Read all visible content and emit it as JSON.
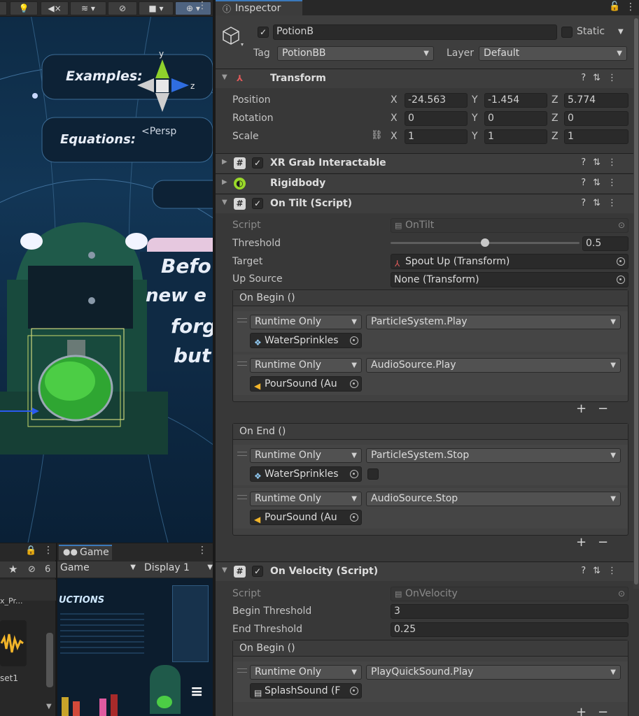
{
  "inspector": {
    "tab_label": "Inspector",
    "object_name": "PotionB",
    "static_label": "Static",
    "tag_label": "Tag",
    "tag_value": "PotionBB",
    "layer_label": "Layer",
    "layer_value": "Default"
  },
  "transform": {
    "title": "Transform",
    "position_label": "Position",
    "rotation_label": "Rotation",
    "scale_label": "Scale",
    "axis_x": "X",
    "axis_y": "Y",
    "axis_z": "Z",
    "position": {
      "x": "-24.563",
      "y": "-1.454",
      "z": "5.774"
    },
    "rotation": {
      "x": "0",
      "y": "0",
      "z": "0"
    },
    "scale": {
      "x": "1",
      "y": "1",
      "z": "1"
    }
  },
  "components": {
    "xr_grab": "XR Grab Interactable",
    "rigidbody": "Rigidbody"
  },
  "on_tilt": {
    "title": "On Tilt (Script)",
    "script_label": "Script",
    "script_value": "OnTilt",
    "threshold_label": "Threshold",
    "threshold_value": "0.5",
    "threshold_fraction": 0.5,
    "target_label": "Target",
    "target_value": "Spout Up (Transform)",
    "up_source_label": "Up Source",
    "up_source_value": "None (Transform)",
    "on_begin": {
      "title": "On Begin ()",
      "entries": [
        {
          "mode": "Runtime Only",
          "function": "ParticleSystem.Play",
          "object": "WaterSprinkles"
        },
        {
          "mode": "Runtime Only",
          "function": "AudioSource.Play",
          "object": "PourSound (Au"
        }
      ]
    },
    "on_end": {
      "title": "On End ()",
      "entries": [
        {
          "mode": "Runtime Only",
          "function": "ParticleSystem.Stop",
          "object": "WaterSprinkles"
        },
        {
          "mode": "Runtime Only",
          "function": "AudioSource.Stop",
          "object": "PourSound (Au"
        }
      ]
    },
    "plus": "+",
    "minus": "−"
  },
  "on_velocity": {
    "title": "On Velocity (Script)",
    "script_label": "Script",
    "script_value": "OnVelocity",
    "begin_label": "Begin Threshold",
    "begin_value": "3",
    "end_label": "End Threshold",
    "end_value": "0.25",
    "on_begin": {
      "title": "On Begin ()",
      "entries": [
        {
          "mode": "Runtime Only",
          "function": "PlayQuickSound.Play",
          "object": "SplashSound (F"
        }
      ]
    }
  },
  "scene": {
    "persp_label": "<Persp",
    "gizmo_y": "y",
    "gizmo_z": "z",
    "words": [
      "Examples:",
      "Equations:",
      "Befo",
      "new e",
      "forg",
      "but"
    ]
  },
  "game": {
    "tab_label": "Game",
    "view_dropdown": "Game",
    "display_dropdown": "Display 1"
  },
  "project": {
    "hidden_count": "6",
    "item_top": "x_Pr...",
    "item_bottom": "set1"
  },
  "colors": {
    "accent": "#3a79bb",
    "panel": "#383838",
    "field": "#2a2a2a"
  }
}
